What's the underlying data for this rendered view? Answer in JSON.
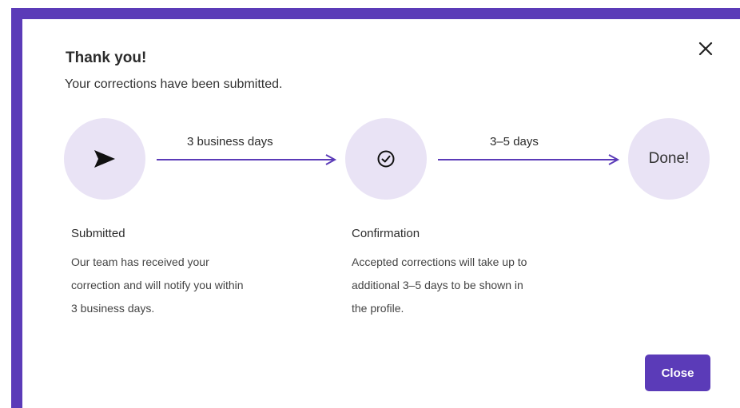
{
  "dialog": {
    "title": "Thank you!",
    "subtitle": "Your corrections have been submitted.",
    "close_button_label": "Close"
  },
  "timeline": {
    "arrows": [
      {
        "label": "3 business days"
      },
      {
        "label": "3–5 days"
      }
    ],
    "steps": [
      {
        "icon": "paper-plane-icon",
        "title": "Submitted",
        "description_lines": [
          "Our team has received your",
          "correction and will notify you within",
          "3 business days."
        ]
      },
      {
        "icon": "check-circle-icon",
        "title": "Confirmation",
        "description_lines": [
          "Accepted corrections will take up to",
          "additional 3–5 days to be shown in",
          "the profile."
        ]
      },
      {
        "label": "Done!"
      }
    ]
  },
  "colors": {
    "accent": "#5b3bb8",
    "circle_fill": "#e9e3f5"
  }
}
